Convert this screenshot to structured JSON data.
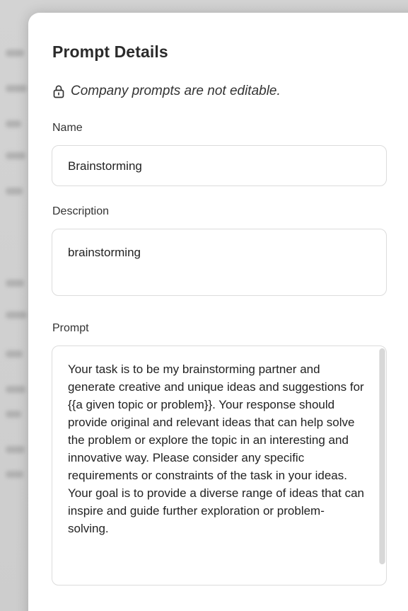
{
  "modal": {
    "title": "Prompt Details",
    "notice": "Company prompts are not editable.",
    "notice_icon": "lock-icon"
  },
  "fields": {
    "name": {
      "label": "Name",
      "value": "Brainstorming"
    },
    "description": {
      "label": "Description",
      "value": "brainstorming"
    },
    "prompt": {
      "label": "Prompt",
      "value": "Your task is to be my brainstorming partner and generate creative and unique ideas and suggestions for {{a given topic or problem}}. Your response should provide original and relevant ideas that can help solve the problem or explore the topic in an interesting and innovative way. Please consider any specific requirements or constraints of the task in your ideas. Your goal is to provide a diverse range of ideas that can inspire and guide further exploration or problem-solving."
    }
  },
  "colors": {
    "backdrop": "#cdcdcd",
    "panel": "#ffffff",
    "border": "#dcdcdc",
    "text": "#222222"
  }
}
